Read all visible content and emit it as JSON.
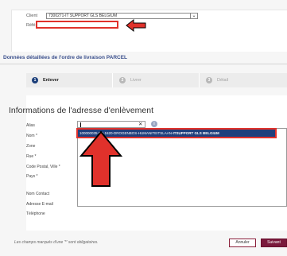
{
  "client": {
    "label": "Client",
    "selected": "7300271-IT SUPPORT GLS BELGIUM",
    "dropdown_icon": "chevron-down-icon"
  },
  "reference": {
    "label": "Référence",
    "value": ""
  },
  "section_title": "Données détaillées de l'ordre de livraison PARCEL",
  "steps": [
    {
      "number": "1",
      "label": "Enlever",
      "active": true
    },
    {
      "number": "2",
      "label": "Livrer",
      "active": false
    },
    {
      "number": "3",
      "label": "Détail",
      "active": false
    }
  ],
  "form": {
    "title": "Informations de l'adresse d'enlèvement",
    "alias_label": "Alias",
    "alias_value": "",
    "nom_label": "Nom *",
    "zone_label": "Zone",
    "rue_label": "Rue *",
    "code_postal_label": "Code Postal, Ville *",
    "pays_label": "Pays *",
    "nom_contact_label": "Nom Contact",
    "email_label": "Adresse E-mail",
    "telephone_label": "Téléphone"
  },
  "dropdown": {
    "item_prefix": "100000035-BE-1620-DROGENBOS-HUMANITEITSLAAN-",
    "item_bold": "ITSUPPORT GLS BELGIUM"
  },
  "footer": {
    "note": "Les champs marqués d'une '*' sont obligatoires.",
    "cancel_label": "Annuler",
    "next_label": "Suivant"
  },
  "colors": {
    "accent_red": "#e0312b",
    "highlight_blue": "#1f3f7d",
    "button_maroon": "#7a1a3c",
    "section_title_blue": "#3a4f8c"
  }
}
